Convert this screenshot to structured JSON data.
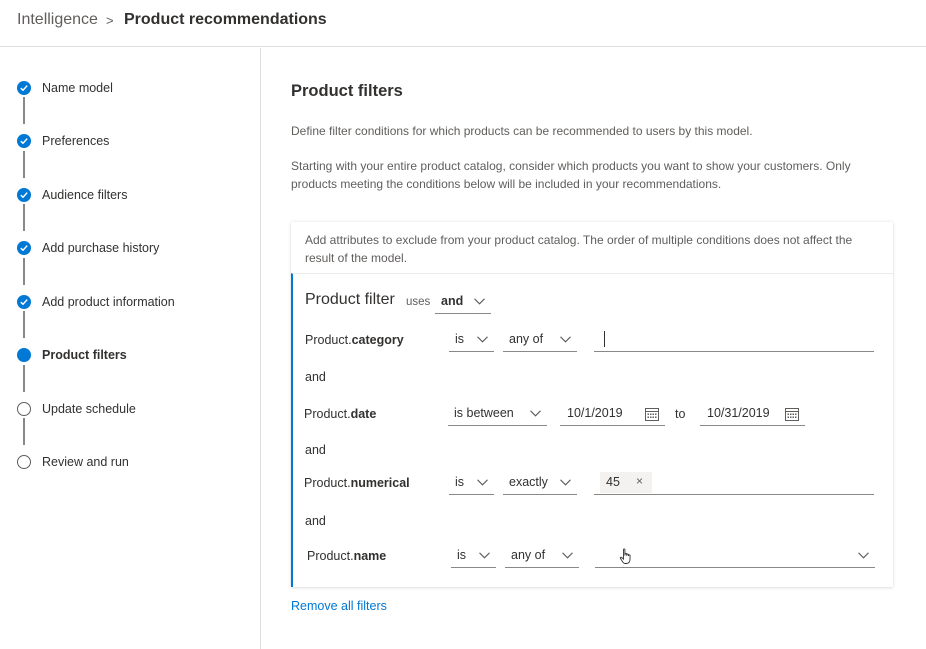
{
  "breadcrumb": {
    "root": "Intelligence",
    "separator": ">",
    "current": "Product recommendations"
  },
  "steps": [
    {
      "label": "Name model",
      "state": "done"
    },
    {
      "label": "Preferences",
      "state": "done"
    },
    {
      "label": "Audience filters",
      "state": "done"
    },
    {
      "label": "Add purchase history",
      "state": "done"
    },
    {
      "label": "Add product information",
      "state": "done"
    },
    {
      "label": "Product filters",
      "state": "current"
    },
    {
      "label": "Update schedule",
      "state": "todo"
    },
    {
      "label": "Review and run",
      "state": "todo"
    }
  ],
  "main": {
    "title": "Product filters",
    "description_1": "Define filter conditions for which products can be recommended to users by this model.",
    "description_2": "Starting with your entire product catalog, consider which products you want to show your customers. Only products meeting the conditions below will be included in your recommendations."
  },
  "card": {
    "note": "Add attributes to exclude from your product catalog. The order of multiple conditions does not affect the result of the model.",
    "filter_title": "Product filter",
    "uses_label": "uses",
    "uses_value": "and",
    "conditions": [
      {
        "attr_prefix": "Product.",
        "attr_name": "category",
        "operator": "is",
        "mode": "any of",
        "value": ""
      },
      {
        "attr_prefix": "Product.",
        "attr_name": "date",
        "operator": "is between",
        "from": "10/1/2019",
        "to_label": "to",
        "to": "10/31/2019"
      },
      {
        "attr_prefix": "Product.",
        "attr_name": "numerical",
        "operator": "is",
        "mode": "exactly",
        "tag": "45",
        "tag_remove": "×"
      },
      {
        "attr_prefix": "Product.",
        "attr_name": "name",
        "operator": "is",
        "mode": "any of",
        "value": ""
      }
    ],
    "joiner": "and"
  },
  "remove_all": "Remove all filters",
  "colors": {
    "accent": "#0078d4",
    "text": "#323130",
    "muted": "#605e5c",
    "border": "#e1dfdd"
  },
  "icons": [
    "checkmark-icon",
    "chevron-down-icon",
    "calendar-icon",
    "close-icon",
    "hand-cursor-icon"
  ]
}
